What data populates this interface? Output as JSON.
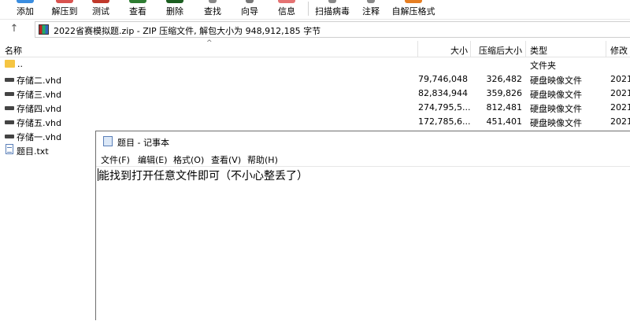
{
  "toolbar": {
    "items": [
      {
        "label": "添加",
        "icon": "add-icon",
        "color": "#3a8de0"
      },
      {
        "label": "解压到",
        "icon": "extract-icon",
        "color": "#d9534f"
      },
      {
        "label": "测试",
        "icon": "test-icon",
        "color": "#c0392b"
      },
      {
        "label": "查看",
        "icon": "view-icon",
        "color": "#2e7d32"
      },
      {
        "label": "删除",
        "icon": "delete-icon",
        "color": "#1b5e20"
      },
      {
        "label": "查找",
        "icon": "find-icon",
        "color": "#888888"
      },
      {
        "label": "向导",
        "icon": "wizard-icon",
        "color": "#777777"
      },
      {
        "label": "信息",
        "icon": "info-icon",
        "color": "#e57373"
      },
      {
        "label": "扫描病毒",
        "icon": "scan-virus-icon",
        "color": "#888888"
      },
      {
        "label": "注释",
        "icon": "comment-icon",
        "color": "#888888"
      },
      {
        "label": "自解压格式",
        "icon": "sfx-icon",
        "color": "#e67e22"
      }
    ]
  },
  "address": {
    "text": "2022省赛模拟题.zip - ZIP 压缩文件, 解包大小为 948,912,185 字节"
  },
  "columns": {
    "name": "名称",
    "size": "大小",
    "packed": "压缩后大小",
    "type": "类型",
    "modified": "修改"
  },
  "files": [
    {
      "name": "..",
      "size": "",
      "packed": "",
      "type": "文件夹",
      "modified": "",
      "kind": "folder"
    },
    {
      "name": "存储二.vhd",
      "size": "79,746,048",
      "packed": "326,482",
      "type": "硬盘映像文件",
      "modified": "2021",
      "kind": "vhd"
    },
    {
      "name": "存储三.vhd",
      "size": "82,834,944",
      "packed": "359,826",
      "type": "硬盘映像文件",
      "modified": "2021",
      "kind": "vhd"
    },
    {
      "name": "存储四.vhd",
      "size": "274,795,5...",
      "packed": "812,481",
      "type": "硬盘映像文件",
      "modified": "2021",
      "kind": "vhd"
    },
    {
      "name": "存储五.vhd",
      "size": "172,785,6...",
      "packed": "451,401",
      "type": "硬盘映像文件",
      "modified": "2021",
      "kind": "vhd"
    },
    {
      "name": "存储一.vhd",
      "size": "",
      "packed": "",
      "type": "",
      "modified": "",
      "kind": "vhd"
    },
    {
      "name": "题目.txt",
      "size": "",
      "packed": "",
      "type": "",
      "modified": "",
      "kind": "txt"
    }
  ],
  "notepad": {
    "title": "题目 - 记事本",
    "menu": [
      "文件(F)",
      "编辑(E)",
      "格式(O)",
      "查看(V)",
      "帮助(H)"
    ],
    "content": "能找到打开任意文件即可（不小心整丢了）"
  }
}
